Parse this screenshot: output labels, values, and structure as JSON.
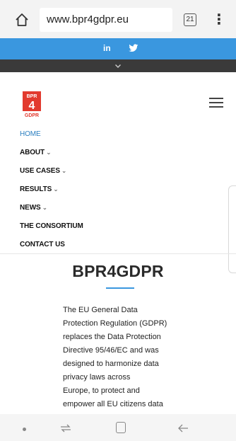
{
  "browser": {
    "url": "www.bpr4gdpr.eu",
    "tab_count": "21"
  },
  "social": {
    "linkedin": "in"
  },
  "logo": {
    "top": "BPR",
    "number": "4",
    "bottom": "GDPR"
  },
  "nav": {
    "items": [
      {
        "label": "HOME",
        "active": true,
        "has_caret": false
      },
      {
        "label": "ABOUT",
        "active": false,
        "has_caret": true
      },
      {
        "label": "USE CASES",
        "active": false,
        "has_caret": true
      },
      {
        "label": "RESULTS",
        "active": false,
        "has_caret": true
      },
      {
        "label": "NEWS",
        "active": false,
        "has_caret": true
      },
      {
        "label": "THE CONSORTIUM",
        "active": false,
        "has_caret": false
      },
      {
        "label": "CONTACT US",
        "active": false,
        "has_caret": false
      }
    ],
    "caret": "⌄"
  },
  "main": {
    "title": "BPR4GDPR",
    "body_lines": [
      "The EU General Data",
      "Protection Regulation (GDPR)",
      "replaces the Data Protection",
      "Directive 95/46/EC and was",
      "designed to harmonize data",
      "privacy laws across",
      "Europe, to protect and",
      "empower all EU citizens data"
    ]
  },
  "colors": {
    "accent_blue": "#3a97df",
    "dark_strip": "#3a3a3a",
    "logo_red": "#e23a2e",
    "active_nav": "#2b7fc0"
  }
}
